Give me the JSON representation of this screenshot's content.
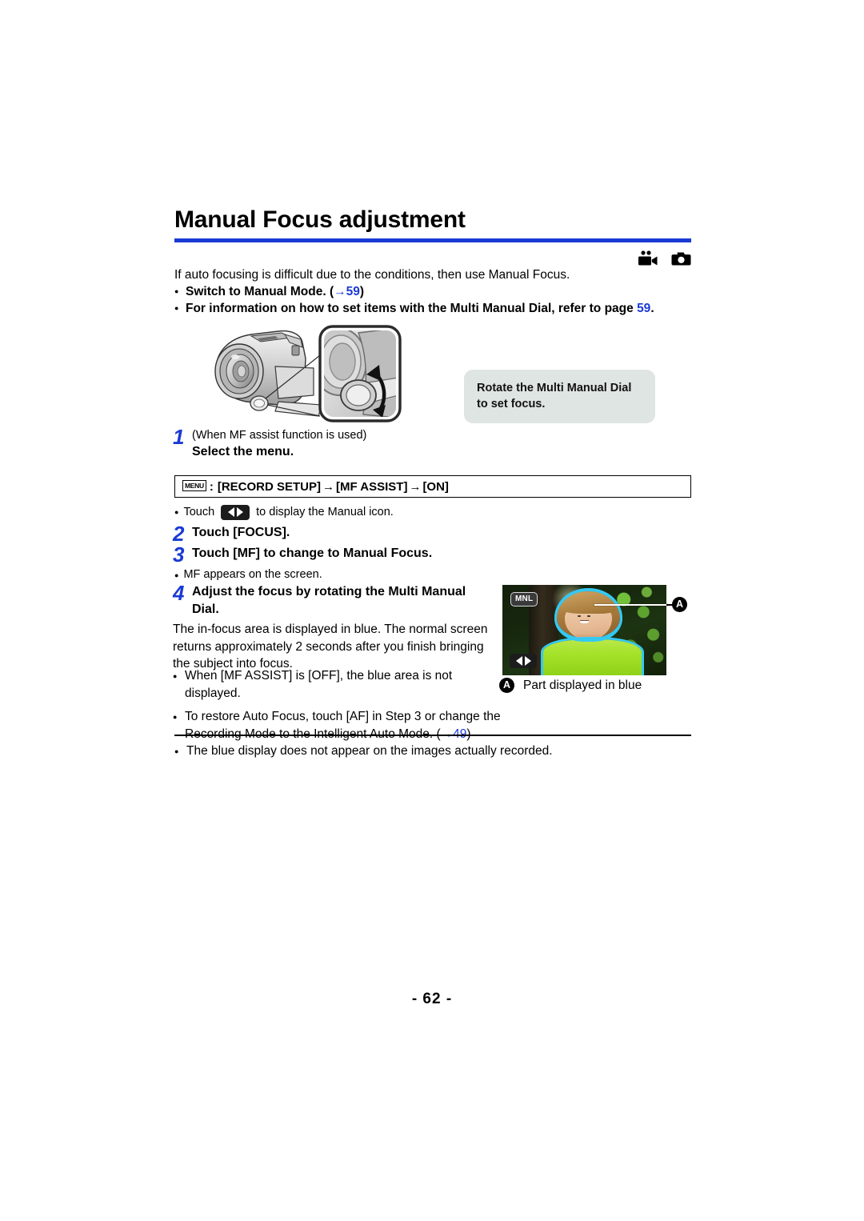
{
  "page": {
    "title": "Manual Focus adjustment",
    "page_number": "- 62 -",
    "accent_color": "#1a3ad6",
    "callout_bg": "#dfe5e3",
    "highlight_blue": "#35c8f2"
  },
  "mode_icons": [
    {
      "name": "video-mode-icon",
      "label": "Motion picture recording mode"
    },
    {
      "name": "photo-mode-icon",
      "label": "Still picture recording mode"
    }
  ],
  "intro": {
    "lead": "If auto focusing is difficult due to the conditions, then use Manual Focus.",
    "bullets": [
      {
        "text_before": "Switch to Manual Mode. (",
        "arrow": "→",
        "link": "59",
        "text_after": ")"
      },
      {
        "text_before": "For information on how to set items with the Multi Manual Dial, refer to page ",
        "arrow": "",
        "link": "59",
        "text_after": "."
      }
    ]
  },
  "illustration": {
    "name": "camcorder-multi-manual-dial-illustration",
    "callout_text": "Rotate the Multi Manual Dial to set focus."
  },
  "steps": [
    {
      "num": "1",
      "sub": "(When MF assist function is used)",
      "bold": "Select the menu."
    },
    {
      "num": "2",
      "bold": "Touch [FOCUS]."
    },
    {
      "num": "3",
      "bold": "Touch [MF] to change to Manual Focus."
    },
    {
      "num": "4",
      "bold": "Adjust the focus by rotating the Multi Manual Dial."
    }
  ],
  "menu_path": {
    "glyph": "MENU",
    "separator": ":",
    "items": [
      "[RECORD SETUP]",
      "[MF ASSIST]",
      "[ON]"
    ],
    "arrow": "→",
    "full": ": [RECORD SETUP] → [MF ASSIST] → [ON]"
  },
  "touch_line": {
    "before": "Touch",
    "after": "to display the Manual icon.",
    "icon": "left-right-arrow-key-icon"
  },
  "step3_note": "MF appears on the screen.",
  "step4_body": "The in-focus area is displayed in blue. The normal screen returns approximately 2 seconds after you finish bringing the subject into focus.",
  "step4_bullets": [
    {
      "text": "When [MF ASSIST] is [OFF], the blue area is not displayed.",
      "arrow": "",
      "link": ""
    },
    {
      "text_before": "To restore Auto Focus, touch [AF] in Step 3 or change the Recording Mode to the Intelligent Auto Mode. (",
      "arrow": "→",
      "link": "49",
      "text_after": ")"
    }
  ],
  "thumbnail": {
    "name": "manual-focus-screen-example",
    "mnl_badge": "MNL",
    "arrow_key_icon": "left-right-arrow-key-icon",
    "marker": "A",
    "caption": "Part displayed in blue"
  },
  "footer_note": "The blue display does not appear on the images actually recorded."
}
